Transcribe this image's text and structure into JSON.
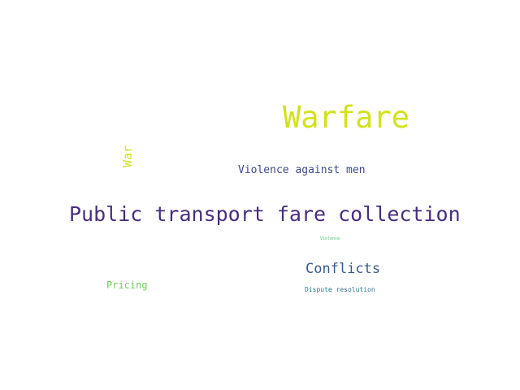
{
  "words": [
    {
      "text": "Warfare",
      "color": "#d2e21b"
    },
    {
      "text": "War",
      "color": "#cde11d"
    },
    {
      "text": "Violence against men",
      "color": "#3e4989"
    },
    {
      "text": "Public transport fare collection",
      "color": "#472f7d"
    },
    {
      "text": "Violence",
      "color": "#4ac16d"
    },
    {
      "text": "Conflicts",
      "color": "#375a8c"
    },
    {
      "text": "Pricing",
      "color": "#6ece58"
    },
    {
      "text": "Dispute resolution",
      "color": "#2a788e"
    }
  ]
}
